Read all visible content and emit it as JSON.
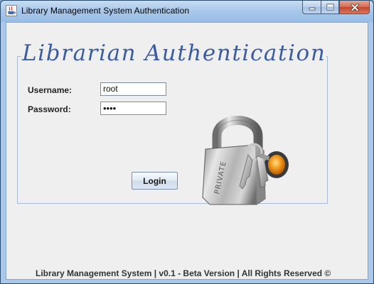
{
  "window": {
    "title": "Library Management System Authentication"
  },
  "form": {
    "heading": "Librarian Authentication",
    "username_label": "Username:",
    "username_value": "root",
    "password_label": "Password:",
    "password_value": "••••",
    "login_label": "Login"
  },
  "footer": {
    "text": "Library Management System | v0.1 - Beta Version | All Rights Reserved ©"
  },
  "icons": {
    "app": "java-cup-icon",
    "illustration": "padlock-keys-private-icon"
  },
  "colors": {
    "heading": "#3a5ca0",
    "client_background": "#efefef",
    "close_button": "#c4452b"
  }
}
